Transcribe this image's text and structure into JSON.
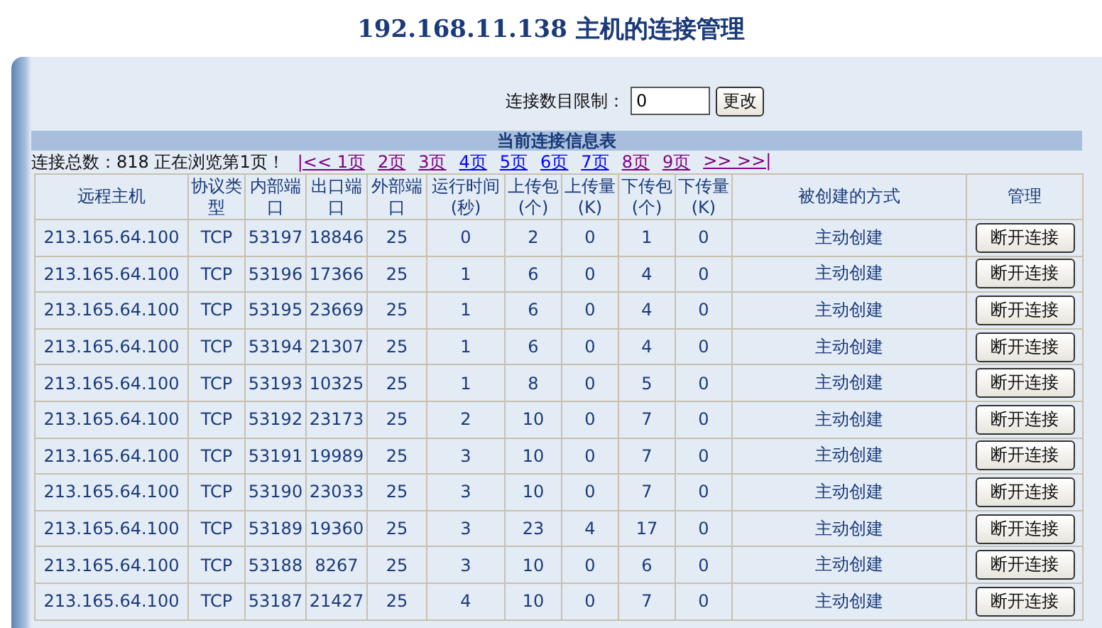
{
  "title": "192.168.11.138 主机的连接管理",
  "limit": {
    "label": "连接数目限制：",
    "value": "0",
    "button": "更改"
  },
  "section_title": "当前连接信息表",
  "summary": "连接总数：818 正在浏览第1页！",
  "pages": [
    {
      "label": "|<< 1页",
      "color": "#800080"
    },
    {
      "label": "2页",
      "color": "#800080"
    },
    {
      "label": "3页",
      "color": "#800080"
    },
    {
      "label": "4页",
      "color": "#0000ff"
    },
    {
      "label": "5页",
      "color": "#0000ff"
    },
    {
      "label": "6页",
      "color": "#0000ff"
    },
    {
      "label": "7页",
      "color": "#0000ff"
    },
    {
      "label": "8页",
      "color": "#800080"
    },
    {
      "label": "9页",
      "color": "#800080"
    },
    {
      "label": ">> >>|",
      "color": "#800080"
    }
  ],
  "table": {
    "columns": [
      "远程主机",
      "协议类型",
      "内部端口",
      "出口端口",
      "外部端口",
      "运行时间(秒)",
      "上传包(个)",
      "上传量(K)",
      "下传包(个)",
      "下传量(K)",
      "被创建的方式",
      "管理"
    ],
    "rows": [
      {
        "cells": [
          "213.165.64.100",
          "TCP",
          "53197",
          "18846",
          "25",
          "0",
          "2",
          "0",
          "1",
          "0",
          "主动创建"
        ],
        "action": "断开连接"
      },
      {
        "cells": [
          "213.165.64.100",
          "TCP",
          "53196",
          "17366",
          "25",
          "1",
          "6",
          "0",
          "4",
          "0",
          "主动创建"
        ],
        "action": "断开连接"
      },
      {
        "cells": [
          "213.165.64.100",
          "TCP",
          "53195",
          "23669",
          "25",
          "1",
          "6",
          "0",
          "4",
          "0",
          "主动创建"
        ],
        "action": "断开连接"
      },
      {
        "cells": [
          "213.165.64.100",
          "TCP",
          "53194",
          "21307",
          "25",
          "1",
          "6",
          "0",
          "4",
          "0",
          "主动创建"
        ],
        "action": "断开连接"
      },
      {
        "cells": [
          "213.165.64.100",
          "TCP",
          "53193",
          "10325",
          "25",
          "1",
          "8",
          "0",
          "5",
          "0",
          "主动创建"
        ],
        "action": "断开连接"
      },
      {
        "cells": [
          "213.165.64.100",
          "TCP",
          "53192",
          "23173",
          "25",
          "2",
          "10",
          "0",
          "7",
          "0",
          "主动创建"
        ],
        "action": "断开连接"
      },
      {
        "cells": [
          "213.165.64.100",
          "TCP",
          "53191",
          "19989",
          "25",
          "3",
          "10",
          "0",
          "7",
          "0",
          "主动创建"
        ],
        "action": "断开连接"
      },
      {
        "cells": [
          "213.165.64.100",
          "TCP",
          "53190",
          "23033",
          "25",
          "3",
          "10",
          "0",
          "7",
          "0",
          "主动创建"
        ],
        "action": "断开连接"
      },
      {
        "cells": [
          "213.165.64.100",
          "TCP",
          "53189",
          "19360",
          "25",
          "3",
          "23",
          "4",
          "17",
          "0",
          "主动创建"
        ],
        "action": "断开连接"
      },
      {
        "cells": [
          "213.165.64.100",
          "TCP",
          "53188",
          "8267",
          "25",
          "3",
          "10",
          "0",
          "6",
          "0",
          "主动创建"
        ],
        "action": "断开连接"
      },
      {
        "cells": [
          "213.165.64.100",
          "TCP",
          "53187",
          "21427",
          "25",
          "4",
          "10",
          "0",
          "7",
          "0",
          "主动创建"
        ],
        "action": "断开连接"
      }
    ]
  }
}
